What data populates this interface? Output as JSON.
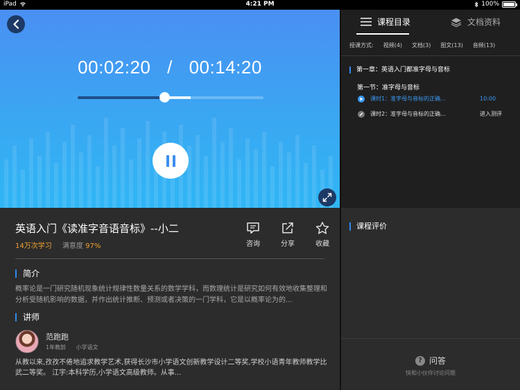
{
  "status_bar": {
    "device": "iPad",
    "time": "4:21 PM",
    "battery": "100%"
  },
  "player": {
    "current_time": "00:02:20",
    "separator": "/",
    "total_time": "00:14:20",
    "progress_fraction": 0.467,
    "buffered_fraction": 0.61,
    "state": "playing"
  },
  "course": {
    "title": "英语入门《读准字音语音标》--小二",
    "learners": "14万次学习",
    "satisfaction_label": "满意度",
    "satisfaction_value": "97%",
    "actions": {
      "consult": "咨询",
      "share": "分享",
      "favorite": "收藏"
    }
  },
  "intro": {
    "heading": "简介",
    "text": "概率论是一门研究随机现象统计规律性数量关系的数学学科，而数理统计是研究如何有效地收集整理和分析受随机影响的数据，并作出统计推断、预测或者决策的一门学科，它是以概率论为的..."
  },
  "teacher": {
    "heading": "讲师",
    "name": "范跑跑",
    "grade": "1年教龄",
    "subject": "小学语文",
    "bio": "从教以来,孜孜不倦地追求教学艺术,获得长沙市小学语文创新教学设计二等奖,学校小语青年教师教学比武二等奖。 江宇:本科学历,小学语文高级教师。从事..."
  },
  "sidebar": {
    "tabs": {
      "catalog": "课程目录",
      "docs": "文档资料"
    },
    "filter": {
      "label": "授课方式:",
      "video": "视频(4)",
      "doc": "文档(3)",
      "image_text": "图文(13)",
      "audio": "音频(13)"
    },
    "chapter": "第一章：英语入门都准字母与音标",
    "section": "第一节：准字母与音标",
    "lessons": [
      {
        "label": "课时1：准字母与音标的正确...",
        "right": "10:00"
      },
      {
        "label": "课时2：准字母与音标的正确...",
        "right": "进入测评"
      }
    ]
  },
  "review": {
    "heading": "课程评价",
    "qa_title": "问答",
    "qa_icon": "?",
    "qa_sub": "快和小伙伴讨论问题"
  }
}
